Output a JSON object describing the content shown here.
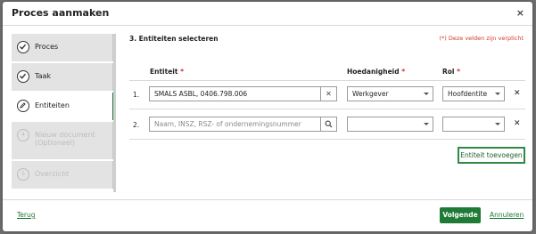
{
  "modal": {
    "title": "Proces aanmaken",
    "close_label": "×"
  },
  "sidebar": {
    "steps": [
      {
        "label": "Proces",
        "state": "done"
      },
      {
        "label": "Taak",
        "state": "done"
      },
      {
        "label": "Entiteiten",
        "state": "active"
      },
      {
        "label": "Nieuw document (Optioneel)",
        "number": "4",
        "state": "disabled"
      },
      {
        "label": "Overzicht",
        "number": "5",
        "state": "disabled"
      }
    ]
  },
  "content": {
    "heading": "3. Entiteiten selecteren",
    "required_note": "(*) Deze velden zijn verplicht",
    "columns": {
      "entity": "Entiteit",
      "capacity": "Hoedanigheid",
      "role": "Rol",
      "required_star": "*"
    },
    "rows": [
      {
        "index": "1.",
        "entity_value": "SMALS ASBL, 0406.798.006",
        "capacity": "Werkgever",
        "role": "Hoofdentite"
      },
      {
        "index": "2.",
        "entity_placeholder": "Naam, INSZ, RSZ- of ondernemingsnummer",
        "capacity": "",
        "role": ""
      }
    ],
    "add_entity_label": "Entiteit toevoegen"
  },
  "footer": {
    "back_label": "Terug",
    "next_label": "Volgende",
    "cancel_label": "Annuleren"
  },
  "colors": {
    "accent": "#1f7a36",
    "required": "#d0372e"
  }
}
